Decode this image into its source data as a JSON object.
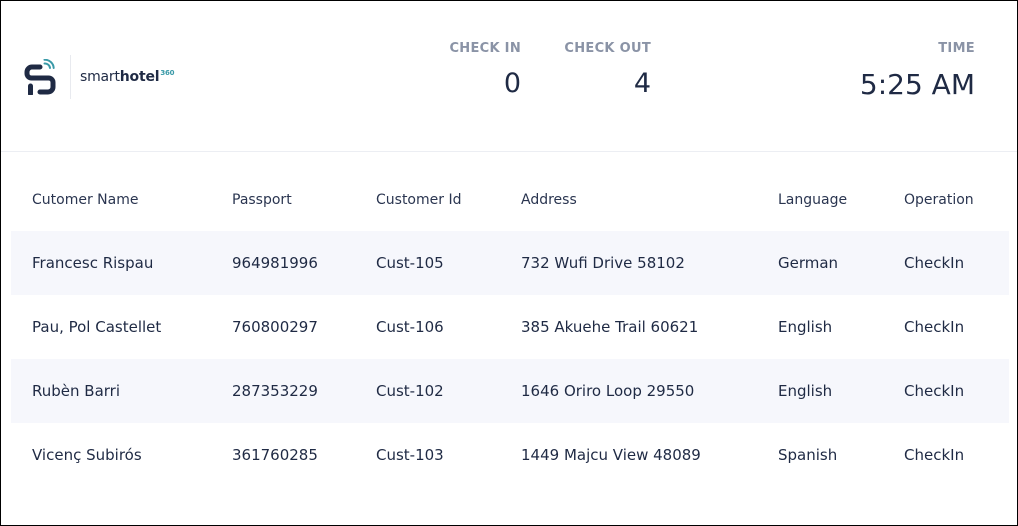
{
  "brand": {
    "name_light": "smart",
    "name_bold": "hotel",
    "superscript": "360",
    "accent_color": "#3a9aa8",
    "logo_icon": "smarthotel-logo-icon"
  },
  "stats": {
    "checkin": {
      "label": "CHECK IN",
      "value": "0"
    },
    "checkout": {
      "label": "CHECK OUT",
      "value": "4"
    },
    "time": {
      "label": "TIME",
      "value": "5:25 AM"
    }
  },
  "table": {
    "columns": [
      "Cutomer Name",
      "Passport",
      "Customer Id",
      "Address",
      "Language",
      "Operation"
    ],
    "rows": [
      [
        "Francesc Rispau",
        "964981996",
        "Cust-105",
        "732 Wufi Drive 58102",
        "German",
        "CheckIn"
      ],
      [
        "Pau, Pol Castellet",
        "760800297",
        "Cust-106",
        "385 Akuehe Trail 60621",
        "English",
        "CheckIn"
      ],
      [
        "Rubèn Barri",
        "287353229",
        "Cust-102",
        "1646 Oriro Loop 29550",
        "English",
        "CheckIn"
      ],
      [
        "Vicenç Subirós",
        "361760285",
        "Cust-103",
        "1449 Majcu View 48089",
        "Spanish",
        "CheckIn"
      ]
    ]
  },
  "colors": {
    "text_primary": "#1f2a44",
    "label_gray": "#8a93a6",
    "row_shade": "#f6f7fc"
  }
}
